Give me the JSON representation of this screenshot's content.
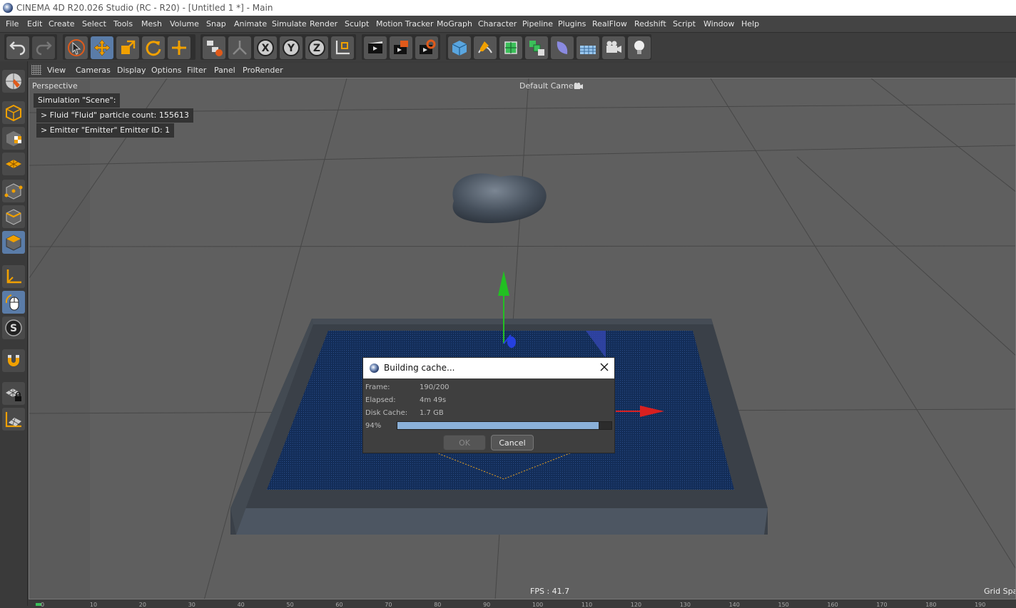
{
  "app": {
    "title": "CINEMA 4D R20.026 Studio (RC - R20) - [Untitled 1 *] - Main"
  },
  "menu": [
    "File",
    "Edit",
    "Create",
    "Select",
    "Tools",
    "Mesh",
    "Volume",
    "Snap",
    "Animate",
    "Simulate",
    "Render",
    "Sculpt",
    "Motion Tracker",
    "MoGraph",
    "Character",
    "Pipeline",
    "Plugins",
    "RealFlow",
    "Redshift",
    "Script",
    "Window",
    "Help"
  ],
  "toolbar": {
    "buttons": [
      "undo-icon",
      "redo-icon",
      "select-arrow-icon",
      "move-icon",
      "scale-icon",
      "rotate-icon",
      "live-select-icon",
      "null-objects-icon",
      "joint-icon",
      "x-axis-icon",
      "y-axis-icon",
      "z-axis-icon",
      "coordinate-system-icon",
      "render-view-icon",
      "render-picture-viewer-icon",
      "render-settings-icon",
      "cube-icon",
      "pen-spline-icon",
      "subdivision-icon",
      "cloner-icon",
      "deformer-icon",
      "floor-icon",
      "camera-icon",
      "light-icon"
    ],
    "active": [
      "move-icon"
    ]
  },
  "sidebar": {
    "buttons": [
      "make-editable-icon",
      "model-mode-icon",
      "texture-mode-icon",
      "workplane-icon",
      "points-mode-icon",
      "edges-mode-icon",
      "polygons-mode-icon",
      "axis-mode-icon",
      "tweak-mode-icon",
      "solo-mode-icon",
      "snapping-icon",
      "workplane-lock-icon",
      "floor-plane-icon"
    ],
    "active": [
      "polygons-mode-icon",
      "tweak-mode-icon"
    ]
  },
  "viewport_menu": [
    "View",
    "Cameras",
    "Display",
    "Options",
    "Filter",
    "Panel",
    "ProRender"
  ],
  "viewport": {
    "name": "Perspective",
    "camera": "Default Camera",
    "fps": "FPS : 41.7",
    "grid_label": "Grid Spac",
    "hud": {
      "title": "Simulation \"Scene\":",
      "line1": "> Fluid \"Fluid\" particle count: 155613",
      "line2": "> Emitter \"Emitter\" Emitter ID: 1"
    }
  },
  "dialog": {
    "title": "Building cache...",
    "frame_label": "Frame:",
    "frame_value": "190/200",
    "elapsed_label": "Elapsed:",
    "elapsed_value": "4m 49s",
    "disk_label": "Disk Cache:",
    "disk_value": "1.7 GB",
    "progress_label": "94%",
    "progress": 0.94,
    "ok": "OK",
    "cancel": "Cancel"
  },
  "timeline": {
    "ticks": [
      "0",
      "10",
      "20",
      "30",
      "40",
      "50",
      "60",
      "70",
      "80",
      "90",
      "100",
      "110",
      "120",
      "130",
      "140",
      "150",
      "160",
      "170",
      "180",
      "190"
    ]
  },
  "colors": {
    "accent": "#5a7ca8",
    "fluid": "#1d3a66",
    "axis_x": "#d82020",
    "axis_y": "#22c022",
    "axis_z": "#2540e0"
  }
}
